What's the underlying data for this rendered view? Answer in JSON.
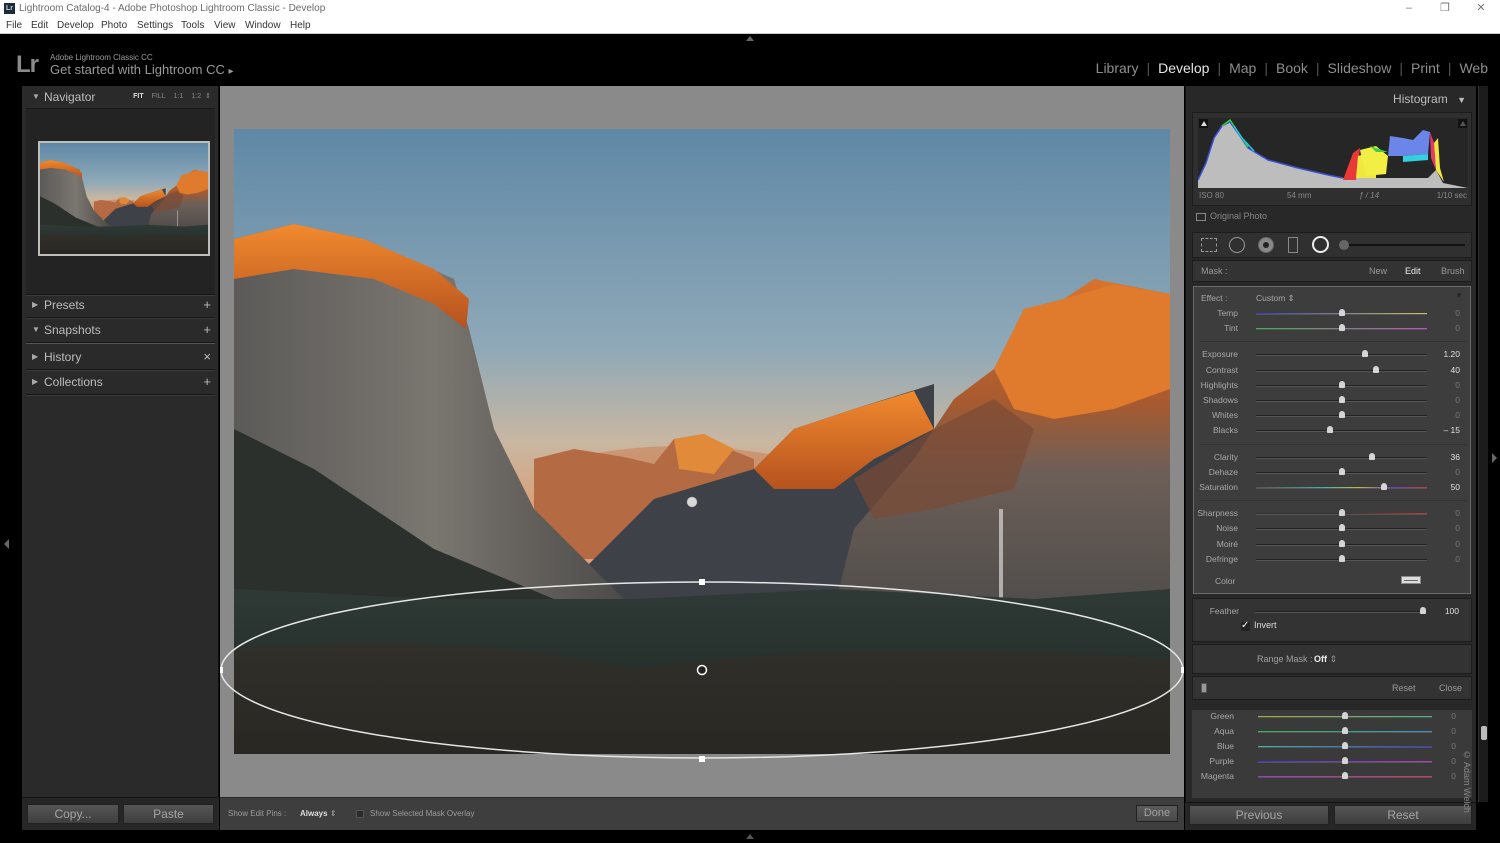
{
  "window": {
    "title": "Lightroom Catalog-4 - Adobe Photoshop Lightroom Classic - Develop",
    "app_icon": "Lr",
    "controls": {
      "minimize": "–",
      "restore": "❐",
      "close": "✕"
    }
  },
  "menu": [
    "File",
    "Edit",
    "Develop",
    "Photo",
    "Settings",
    "Tools",
    "View",
    "Window",
    "Help"
  ],
  "identity_plate": {
    "logo": "Lr",
    "product": "Adobe Lightroom Classic CC",
    "tagline": "Get started with Lightroom CC",
    "tagline_arrow": "▸"
  },
  "modules": [
    {
      "label": "Library",
      "active": false
    },
    {
      "label": "Develop",
      "active": true
    },
    {
      "label": "Map",
      "active": false
    },
    {
      "label": "Book",
      "active": false
    },
    {
      "label": "Slideshow",
      "active": false
    },
    {
      "label": "Print",
      "active": false
    },
    {
      "label": "Web",
      "active": false
    }
  ],
  "left_panel": {
    "navigator": {
      "label": "Navigator",
      "zoom_options": [
        "FIT",
        "FILL",
        "1:1",
        "1:2"
      ],
      "zoom_selected": "FIT",
      "zoom_stepper": "⇕"
    },
    "sections": [
      {
        "label": "Presets",
        "expanded": false,
        "action": "+"
      },
      {
        "label": "Snapshots",
        "expanded": true,
        "action": "+"
      },
      {
        "label": "History",
        "expanded": false,
        "action": "×"
      },
      {
        "label": "Collections",
        "expanded": false,
        "action": "+"
      }
    ],
    "copy_button": "Copy...",
    "paste_button": "Paste"
  },
  "toolbar": {
    "show_edit_pins_label": "Show Edit Pins :",
    "show_edit_pins_value": "Always",
    "mask_overlay_label": "Show Selected Mask Overlay",
    "mask_overlay_checked": false,
    "done_button": "Done"
  },
  "right_panel": {
    "histogram": {
      "label": "Histogram",
      "iso": "ISO 80",
      "focal_length": "54 mm",
      "aperture": "ƒ / 14",
      "shutter": "1/10 sec",
      "original_photo_label": "Original Photo"
    },
    "mask": {
      "label": "Mask :",
      "new": "New",
      "edit": "Edit",
      "brush": "Brush",
      "active": "Edit"
    },
    "effect": {
      "label": "Effect :",
      "preset": "Custom",
      "groups": [
        [
          {
            "label": "Temp",
            "value": "0",
            "pos": 0.5,
            "track": "temp"
          },
          {
            "label": "Tint",
            "value": "0",
            "pos": 0.5,
            "track": "tint"
          }
        ],
        [
          {
            "label": "Exposure",
            "value": "1.20",
            "pos": 0.64,
            "track": "plain"
          },
          {
            "label": "Contrast",
            "value": "40",
            "pos": 0.7,
            "track": "plain"
          },
          {
            "label": "Highlights",
            "value": "0",
            "pos": 0.5,
            "track": "plain"
          },
          {
            "label": "Shadows",
            "value": "0",
            "pos": 0.5,
            "track": "plain"
          },
          {
            "label": "Whites",
            "value": "0",
            "pos": 0.5,
            "track": "plain"
          },
          {
            "label": "Blacks",
            "value": "– 15",
            "pos": 0.43,
            "track": "plain"
          }
        ],
        [
          {
            "label": "Clarity",
            "value": "36",
            "pos": 0.68,
            "track": "plain"
          },
          {
            "label": "Dehaze",
            "value": "0",
            "pos": 0.5,
            "track": "plain"
          },
          {
            "label": "Saturation",
            "value": "50",
            "pos": 0.75,
            "track": "sat"
          }
        ],
        [
          {
            "label": "Sharpness",
            "value": "0",
            "pos": 0.5,
            "track": "sharp"
          },
          {
            "label": "Noise",
            "value": "0",
            "pos": 0.5,
            "track": "plain"
          },
          {
            "label": "Moiré",
            "value": "0",
            "pos": 0.5,
            "track": "plain"
          },
          {
            "label": "Defringe",
            "value": "0",
            "pos": 0.5,
            "track": "plain"
          }
        ]
      ],
      "color_label": "Color"
    },
    "feather": {
      "label": "Feather",
      "value": "100",
      "pos": 1.0
    },
    "invert": {
      "label": "Invert",
      "checked": true
    },
    "range_mask": {
      "label": "Range Mask :",
      "value": "Off"
    },
    "reset": "Reset",
    "close": "Close",
    "hsl": [
      {
        "label": "Green",
        "value": "0",
        "pos": 0.5,
        "track": "green"
      },
      {
        "label": "Aqua",
        "value": "0",
        "pos": 0.5,
        "track": "aqua"
      },
      {
        "label": "Blue",
        "value": "0",
        "pos": 0.5,
        "track": "blue"
      },
      {
        "label": "Purple",
        "value": "0",
        "pos": 0.5,
        "track": "purple"
      },
      {
        "label": "Magenta",
        "value": "0",
        "pos": 0.5,
        "track": "magenta"
      }
    ],
    "previous_button": "Previous",
    "reset_button": "Reset",
    "watermark": "© Adam Welch"
  },
  "colors": {
    "panel_bg": "#282828",
    "canvas_bg": "#8a8a8a",
    "active_module": "#e6e6e6",
    "inactive_text": "#8e8e8e"
  }
}
